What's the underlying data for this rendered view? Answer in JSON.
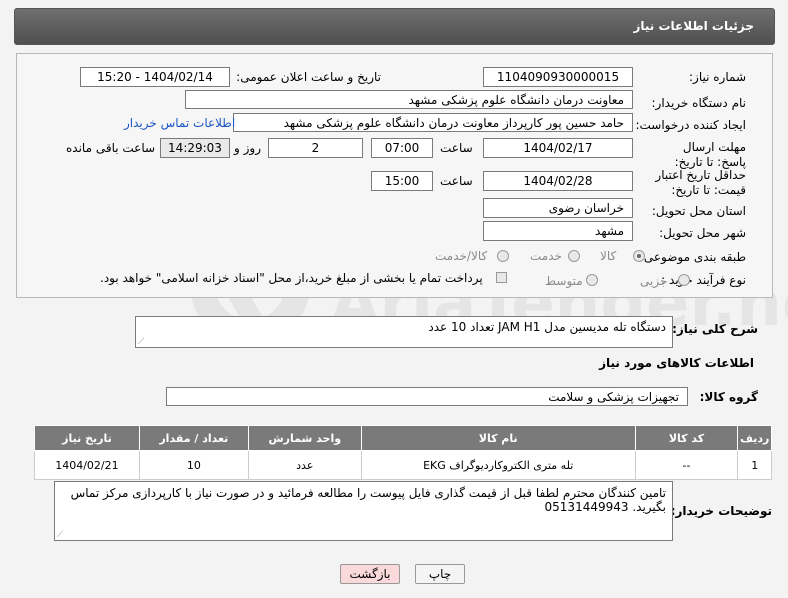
{
  "header": {
    "title": "جزئیات اطلاعات نیاز"
  },
  "form": {
    "need_number_label": "شماره نیاز:",
    "need_number": "1104090930000015",
    "announce_label": "تاریخ و ساعت اعلان عمومی:",
    "announce_value": "1404/02/14 - 15:20",
    "buyer_org_label": "نام دستگاه خریدار:",
    "buyer_org": "معاونت درمان دانشگاه علوم پزشکی مشهد",
    "creator_label": "ایجاد کننده درخواست:",
    "creator": "حامد حسین پور کارپرداز معاونت درمان دانشگاه علوم پزشکی مشهد",
    "contact_link": "اطلاعات تماس خریدار",
    "reply_deadline_label": "مهلت ارسال پاسخ: تا تاریخ:",
    "reply_date": "1404/02/17",
    "time_label": "ساعت",
    "reply_time": "07:00",
    "days_value": "2",
    "days_label": "روز و",
    "remaining_time": "14:29:03",
    "remaining_label": "ساعت باقی مانده",
    "price_validity_label": "حداقل تاریخ اعتبار قیمت: تا تاریخ:",
    "price_date": "1404/02/28",
    "price_time": "15:00",
    "province_label": "استان محل تحویل:",
    "province": "خراسان رضوی",
    "city_label": "شهر محل تحویل:",
    "city": "مشهد",
    "category_label": "طبقه بندی موضوعی:",
    "category_options": [
      "کالا",
      "خدمت",
      "کالا/خدمت"
    ],
    "category_selected": "کالا",
    "purchase_type_label": "نوع فرآیند خرید :",
    "purchase_options": [
      "جزیی",
      "متوسط"
    ],
    "purchase_note": "پرداخت تمام یا بخشی از مبلغ خرید،از محل \"اسناد خزانه اسلامی\" خواهد بود."
  },
  "description": {
    "label": "شرح کلی نیاز:",
    "text": "دستگاه تله مدیسین  مدل JAM H1 تعداد 10 عدد"
  },
  "goods_section": {
    "title": "اطلاعات کالاهای مورد نیاز",
    "group_label": "گروه کالا:",
    "group_value": "تجهیزات پزشکی و سلامت"
  },
  "table": {
    "headers": [
      "ردیف",
      "کد کالا",
      "نام کالا",
      "واحد شمارش",
      "تعداد / مقدار",
      "تاریخ نیاز"
    ],
    "rows": [
      [
        "1",
        "--",
        "تله متری الکتروکاردیوگراف EKG",
        "عدد",
        "10",
        "1404/02/21"
      ]
    ]
  },
  "buyer_notes": {
    "label": "توضیحات خریدار:",
    "text": "تامین کنندگان محترم لطفا قبل از قیمت گذاری فایل پیوست را مطالعه فرمائید و در صورت نیاز با کارپردازی مرکز تماس بگیرید. 05131449943"
  },
  "buttons": {
    "print": "چاپ",
    "back": "بازگشت"
  },
  "watermark": {
    "text": "AriaTender.net"
  },
  "colors": {
    "header_bg": "#5f5f5f",
    "table_header_bg": "#7a7a7a",
    "link": "#1a56c6",
    "back_button_bg": "#f9d9d9"
  }
}
